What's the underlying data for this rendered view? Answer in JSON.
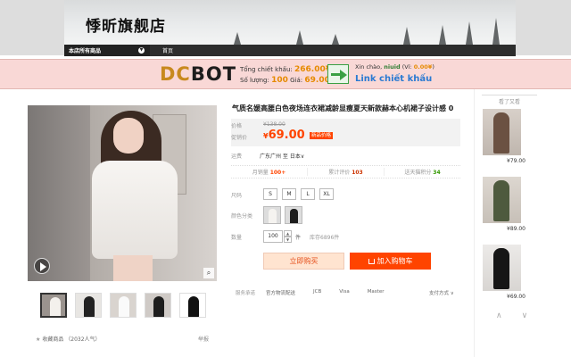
{
  "store": {
    "name": "悸昕旗舰店",
    "nav": {
      "all_products": "本店所有商品",
      "home": "首页"
    }
  },
  "dcbot": {
    "logo_dc": "DC",
    "logo_bot": "BOT",
    "total_label": "Tổng chiết khấu:",
    "total_value": "266.00¥",
    "qty_label": "Số lượng:",
    "qty_value": "100",
    "price_label": "Giá:",
    "price_value": "69.00¥",
    "greeting": "Xin chào,",
    "user": "niuid",
    "wallet_label": "(Ví:",
    "wallet_value": "0.00¥",
    "wallet_close": ")",
    "link": "Link chiết khấu",
    "accent_color": "#e68a00",
    "link_color": "#2a7ad2"
  },
  "product": {
    "title": "气质名媛高腰白色夜场连衣裙减龄显瘦夏天新款赫本心机裙子设计感 0",
    "price_label": "价格",
    "original_price": "¥138.00",
    "promo_label": "促销价",
    "promo_price": "69.00",
    "promo_currency": "¥",
    "promo_tag": "新品价格",
    "shipping_label": "运费",
    "shipping_value": "广东广州 至 日本",
    "shipping_value_suffix": "∨",
    "stats": {
      "monthly_label": "月销量",
      "monthly_value": "100+",
      "reviews_label": "累计评价",
      "reviews_value": "103",
      "points_label": "送天猫积分",
      "points_value": "34"
    },
    "size_label": "尺码",
    "sizes": [
      "S",
      "M",
      "L",
      "XL"
    ],
    "color_label": "颜色分类",
    "qty_label": "数量",
    "qty_value": "100",
    "qty_unit": "件",
    "stock": "库存6896件",
    "buy_now": "立即购买",
    "add_to_cart": "加入购物车",
    "services_label": "服务承诺",
    "services": [
      "官方物流配送",
      "JCB",
      "Visa",
      "Master"
    ],
    "payment": "支付方式 ∨",
    "brand_color": "#ff4400"
  },
  "gallery": {
    "zoom_icon": "search-icon",
    "favorite": "收藏商品",
    "favorite_count": "（2032人气）",
    "report": "举报"
  },
  "sidebar": {
    "title": "看了又看",
    "items": [
      {
        "price": "¥79.00"
      },
      {
        "price": "¥89.00"
      },
      {
        "price": "¥69.00"
      }
    ],
    "up": "∧",
    "down": "∨"
  }
}
